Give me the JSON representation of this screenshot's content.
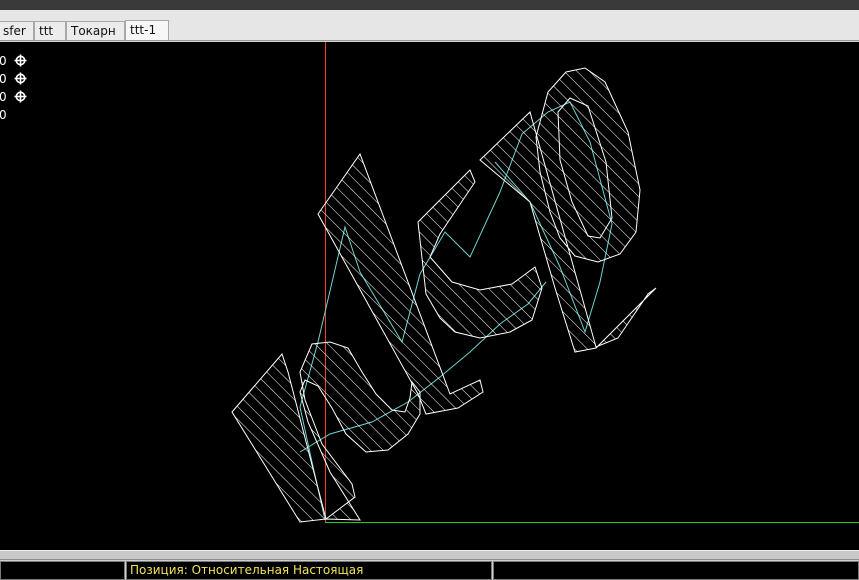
{
  "tabs": [
    {
      "label": "sfer",
      "active": false
    },
    {
      "label": "ttt",
      "active": false
    },
    {
      "label": "Токарн",
      "active": false
    },
    {
      "label": "ttt-1",
      "active": true
    }
  ],
  "coords": [
    {
      "value": "0",
      "icon": "move-cross-icon"
    },
    {
      "value": "0",
      "icon": "move-cross-icon"
    },
    {
      "value": "0",
      "icon": "move-cross-icon"
    },
    {
      "value": "0",
      "icon": ""
    }
  ],
  "axes": {
    "x_color": "#22cc22",
    "y_color": "#ff3a2a"
  },
  "drawing": {
    "glyphs": [
      "r",
      "k",
      "p"
    ],
    "stroke_color": "#ffffff",
    "path_color": "#6fd3d3"
  },
  "status": {
    "left": "",
    "position": "Позиция: Относительная Настоящая",
    "right": ""
  }
}
